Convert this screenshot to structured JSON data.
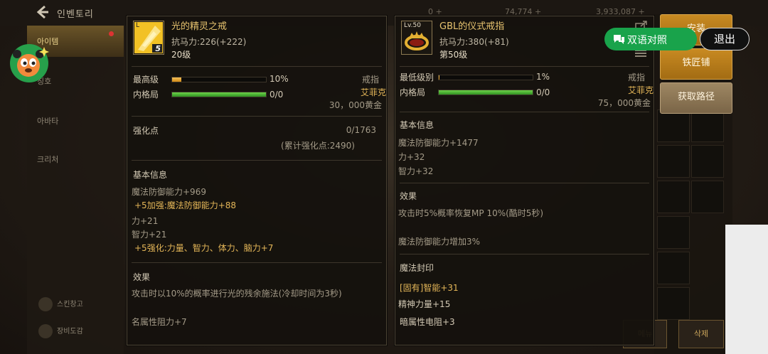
{
  "topbar": {
    "title": "인벤토리",
    "stat1": "0 +",
    "stat2": "74,774 +",
    "stat3": "3,933,087 +"
  },
  "leftnav": {
    "items": [
      {
        "label": "아이템",
        "active": true
      },
      {
        "label": "칭호",
        "active": false
      },
      {
        "label": "아바타",
        "active": false
      },
      {
        "label": "크리처",
        "active": false
      }
    ],
    "bottom": [
      "스킨창고",
      "장비도감"
    ]
  },
  "overlay": {
    "bilingual_label": "双语对照",
    "exit_label": "退出"
  },
  "side_buttons": {
    "install": "安装",
    "blacksmith": "铁匠铺",
    "acquire": "获取路径"
  },
  "bottom_buttons": [
    "메뉴",
    "삭제"
  ],
  "item1": {
    "name": "光的精灵之戒",
    "resist": "抗马力:226(+222)",
    "level": "20级",
    "badge": "5",
    "icon_level": "L",
    "highest_label": "最高级",
    "highest_pct": "10%",
    "highest_value": 0.1,
    "inner_label": "内格局",
    "inner_value_text": "0/0",
    "inner_value": 1.0,
    "type": "戒指",
    "class": "艾菲克",
    "price": "30，000黄金",
    "enhance_label": "强化点",
    "enhance_value": "0/1763",
    "enhance_total": "(累计强化点:2490)",
    "basic_title": "基本信息",
    "basic": [
      {
        "text": "魔法防御能力+969",
        "gold": false
      },
      {
        "text": "+5加强:魔法防御能力+88",
        "gold": true
      },
      {
        "text": "力+21",
        "gold": false
      },
      {
        "text": "智力+21",
        "gold": false
      },
      {
        "text": "+5强化:力量、智力、体力、脑力+7",
        "gold": true
      }
    ],
    "effect_title": "效果",
    "effect": "攻击时以10%的概率进行光的残余施法(冷却时间为3秒)",
    "effect2": "名属性阻力+7"
  },
  "item2": {
    "name": "GBL的仪式戒指",
    "resist": "抗马力:380(+81)",
    "level": "第50级",
    "icon_level": "Lv.50",
    "lowest_label": "最低级别",
    "lowest_pct": "1%",
    "lowest_value": 0.01,
    "inner_label": "内格局",
    "inner_value_text": "0/0",
    "inner_value": 1.0,
    "type": "戒指",
    "class": "艾菲克",
    "price": "75，000黄金",
    "basic_title": "基本信息",
    "basic": [
      "魔法防御能力+1477",
      "力+32",
      "智力+32"
    ],
    "effect_title": "效果",
    "effect": "攻击时5%概率恢复MP 10%(酷时5秒)",
    "effect2": "魔法防御能力增加3%",
    "seal_title": "魔法封印",
    "seal": [
      {
        "text": "[固有]智能+31",
        "gold": true
      },
      {
        "text": "精神力量+15",
        "gold": false
      },
      {
        "text": "暗属性电阻+3",
        "gold": false
      }
    ]
  }
}
